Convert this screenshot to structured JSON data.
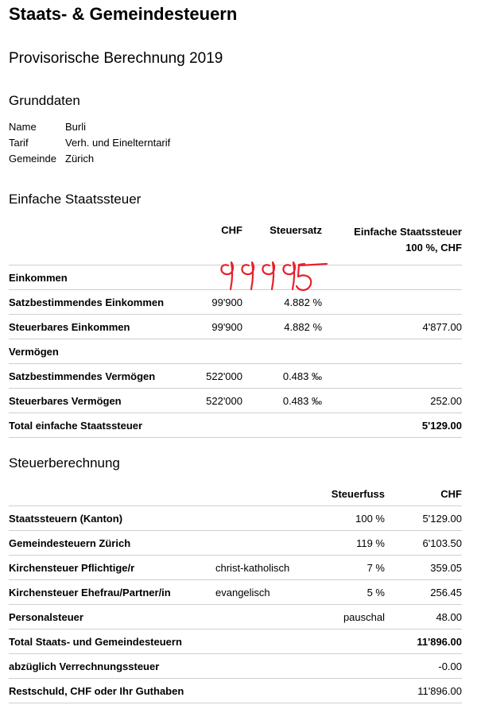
{
  "title": "Staats- & Gemeindesteuern",
  "subtitle": "Provisorische Berechnung 2019",
  "grunddaten": {
    "heading": "Grunddaten",
    "rows": [
      {
        "key": "Name",
        "value": "Burli"
      },
      {
        "key": "Tarif",
        "value": "Verh. und Einelterntarif"
      },
      {
        "key": "Gemeinde",
        "value": "Zürich"
      }
    ]
  },
  "staatssteuer": {
    "heading": "Einfache Staatssteuer",
    "headers": {
      "chf": "CHF",
      "satz": "Steuersatz",
      "einfach_line1": "Einfache Staatssteuer",
      "einfach_line2": "100 %, CHF"
    },
    "rows": [
      {
        "label": "Einkommen",
        "chf": "",
        "satz": "",
        "value": ""
      },
      {
        "label": "Satzbestimmendes Einkommen",
        "chf": "99'900",
        "satz": "4.882 %",
        "value": ""
      },
      {
        "label": "Steuerbares Einkommen",
        "chf": "99'900",
        "satz": "4.882 %",
        "value": "4'877.00"
      },
      {
        "label": "Vermögen",
        "chf": "",
        "satz": "",
        "value": ""
      },
      {
        "label": "Satzbestimmendes Vermögen",
        "chf": "522'000",
        "satz": "0.483 ‰",
        "value": ""
      },
      {
        "label": "Steuerbares Vermögen",
        "chf": "522'000",
        "satz": "0.483 ‰",
        "value": "252.00"
      }
    ],
    "total_label": "Total einfache Staatssteuer",
    "total_value": "5'129.00"
  },
  "annotation": {
    "text": "99995",
    "color": "#e8202a"
  },
  "berechnung": {
    "heading": "Steuerberechnung",
    "headers": {
      "fuss": "Steuerfuss",
      "chf": "CHF"
    },
    "rows": [
      {
        "label": "Staatssteuern (Kanton)",
        "detail": "",
        "fuss": "100 %",
        "chf": "5'129.00"
      },
      {
        "label": "Gemeindesteuern Zürich",
        "detail": "",
        "fuss": "119 %",
        "chf": "6'103.50"
      },
      {
        "label": "Kirchensteuer Pflichtige/r",
        "detail": "christ-katholisch",
        "fuss": "7 %",
        "chf": "359.05"
      },
      {
        "label": "Kirchensteuer Ehefrau/Partner/in",
        "detail": "evangelisch",
        "fuss": "5 %",
        "chf": "256.45"
      },
      {
        "label": "Personalsteuer",
        "detail": "",
        "fuss": "pauschal",
        "chf": "48.00"
      }
    ],
    "total_label": "Total Staats- und Gemeindesteuern",
    "total_value": "11'896.00",
    "verrechnung_label": "abzüglich Verrechnungssteuer",
    "verrechnung_value": "-0.00",
    "rest_label": "Restschuld, CHF oder Ihr Guthaben",
    "rest_value": "11'896.00"
  }
}
